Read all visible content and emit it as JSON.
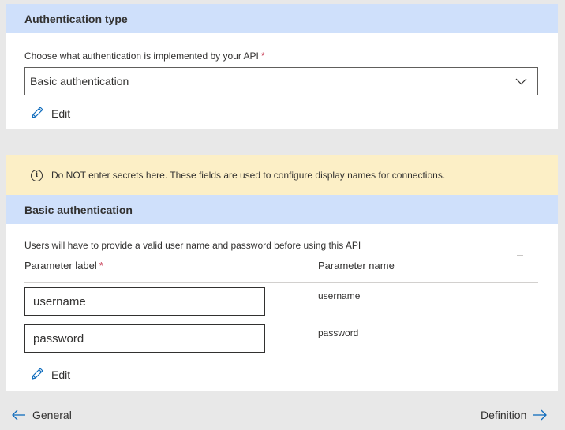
{
  "auth_type": {
    "title": "Authentication type",
    "description": "Choose what authentication is implemented by your API",
    "required_mark": "*",
    "selected": "Basic authentication",
    "edit_label": "Edit"
  },
  "warning_banner": {
    "text": "Do NOT enter secrets here. These fields are used to configure display names for connections.",
    "icon": "info-icon"
  },
  "basic_auth": {
    "title": "Basic authentication",
    "description": "Users will have to provide a valid user name and password before using this API",
    "columns": {
      "label_header": "Parameter label",
      "required_mark": "*",
      "name_header": "Parameter name"
    },
    "rows": [
      {
        "label_value": "username",
        "parameter_name": "username"
      },
      {
        "label_value": "password",
        "parameter_name": "password"
      }
    ],
    "edit_label": "Edit"
  },
  "navigation": {
    "back_label": "General",
    "next_label": "Definition"
  },
  "colors": {
    "header_bg": "#cfe0fb",
    "banner_bg": "#fcefc6",
    "accent": "#0f6cbd",
    "required": "#c4314b"
  }
}
